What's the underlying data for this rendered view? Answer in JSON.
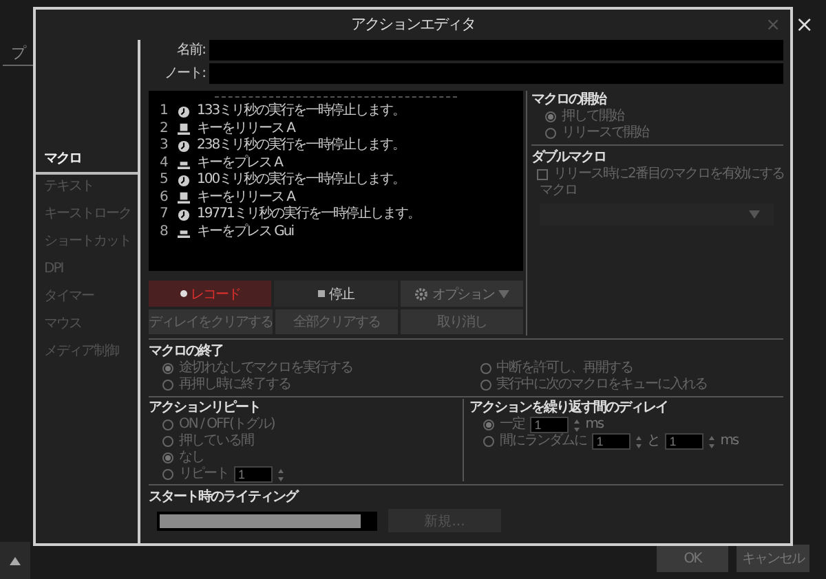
{
  "background": {
    "tab_label": "プ",
    "close": "×",
    "buttons": [
      "OK",
      "キャンセル"
    ]
  },
  "dialog": {
    "title": "アクションエディタ",
    "close": "×"
  },
  "sidebar": {
    "items": [
      {
        "label": "マクロ",
        "selected": true
      },
      {
        "label": "テキスト",
        "selected": false
      },
      {
        "label": "キーストローク",
        "selected": false
      },
      {
        "label": "ショートカット",
        "selected": false
      },
      {
        "label": "DPI",
        "selected": false
      },
      {
        "label": "タイマー",
        "selected": false
      },
      {
        "label": "マウス",
        "selected": false
      },
      {
        "label": "メディア制御",
        "selected": false
      }
    ]
  },
  "fields": [
    {
      "label": "名前:"
    },
    {
      "label": "ノート:"
    }
  ],
  "steps": [
    {
      "index": "1",
      "kind": "delay",
      "text": "133ミリ秒の実行を一時停止します。"
    },
    {
      "index": "2",
      "kind": "release",
      "text": "キーをリリース A"
    },
    {
      "index": "3",
      "kind": "delay",
      "text": "238ミリ秒の実行を一時停止します。"
    },
    {
      "index": "4",
      "kind": "press",
      "text": "キーをプレス A"
    },
    {
      "index": "5",
      "kind": "delay",
      "text": "100ミリ秒の実行を一時停止します。"
    },
    {
      "index": "6",
      "kind": "release",
      "text": "キーをリリース A"
    },
    {
      "index": "7",
      "kind": "delay",
      "text": "19771ミリ秒の実行を一時停止します。"
    },
    {
      "index": "8",
      "kind": "press",
      "text": "キーをプレス Gui"
    }
  ],
  "record_buttons": [
    {
      "kind": "record",
      "label": "レコード"
    },
    {
      "kind": "stop",
      "label": "停止"
    },
    {
      "kind": "options",
      "label": "オプション"
    }
  ],
  "edit_buttons": [
    "ディレイをクリアする",
    "全部クリアする",
    "取り消し"
  ],
  "macro_start": {
    "title": "マクロの開始",
    "options": [
      {
        "label": "押して開始",
        "selected": true
      },
      {
        "label": "リリースで開始",
        "selected": false
      }
    ]
  },
  "double_macro": {
    "title": "ダブルマクロ",
    "checkbox": {
      "label": "リリース時に2番目のマクロを有効にする",
      "checked": false
    },
    "dropdown_label": "マクロ"
  },
  "macro_end": {
    "title": "マクロの終了",
    "options": [
      {
        "label": "途切れなしでマクロを実行する",
        "selected": true
      },
      {
        "label": "中断を許可し、再開する",
        "selected": false
      },
      {
        "label": "再押し時に終了する",
        "selected": false
      },
      {
        "label": "実行中に次のマクロをキューに入れる",
        "selected": false
      }
    ]
  },
  "action_repeat": {
    "title": "アクションリピート",
    "options": [
      {
        "label": "ON / OFF(トグル)",
        "selected": false
      },
      {
        "label": "押している間",
        "selected": false
      },
      {
        "label": "なし",
        "selected": true
      },
      {
        "label": "リピート",
        "selected": false,
        "value": "1"
      }
    ]
  },
  "repeat_delay": {
    "title": "アクションを繰り返す間のディレイ",
    "fixed": {
      "label": "一定",
      "selected": true,
      "value": "1",
      "unit": "ms"
    },
    "random": {
      "label": "間にランダムに",
      "selected": false,
      "from": "1",
      "joiner": "と",
      "to": "1",
      "unit": "ms"
    }
  },
  "start_lighting": {
    "title": "スタート時のライティング",
    "new_button": "新規..."
  }
}
